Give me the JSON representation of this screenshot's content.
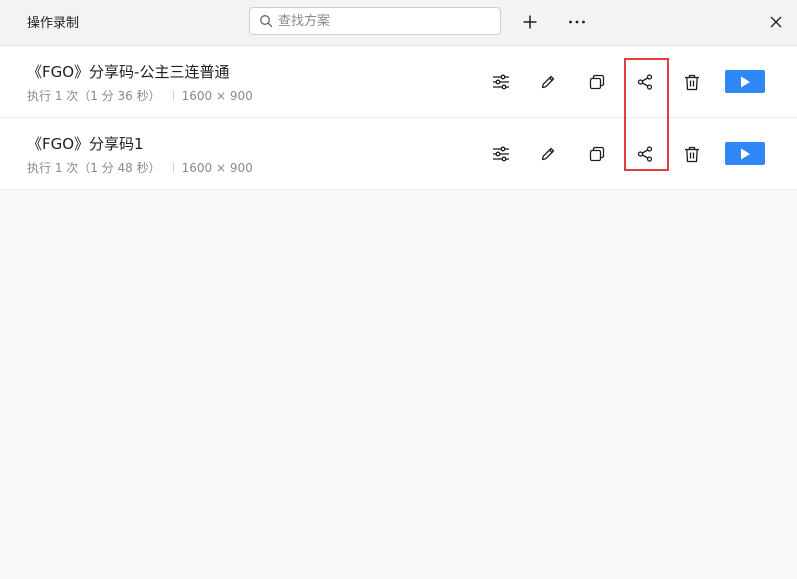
{
  "app": {
    "title": "操作录制"
  },
  "toolbar": {
    "search_placeholder": "查找方案",
    "add_icon": "plus-icon",
    "more_icon": "more-horizontal-icon",
    "close_icon": "close-icon"
  },
  "recordings": [
    {
      "name": "《FGO》分享码-公主三连普通",
      "runs": "执行 1 次（1 分 36 秒）",
      "resolution": "1600 × 900"
    },
    {
      "name": "《FGO》分享码1",
      "runs": "执行 1 次（1 分 48 秒）",
      "resolution": "1600 × 900"
    }
  ],
  "row_actions": [
    "settings-sliders-icon",
    "edit-pencil-icon",
    "copy-icon",
    "share-icon",
    "trash-icon",
    "play-icon"
  ],
  "colors": {
    "accent": "#2f86f6",
    "highlight": "#e53e3e",
    "background": "#f9f9f9"
  }
}
